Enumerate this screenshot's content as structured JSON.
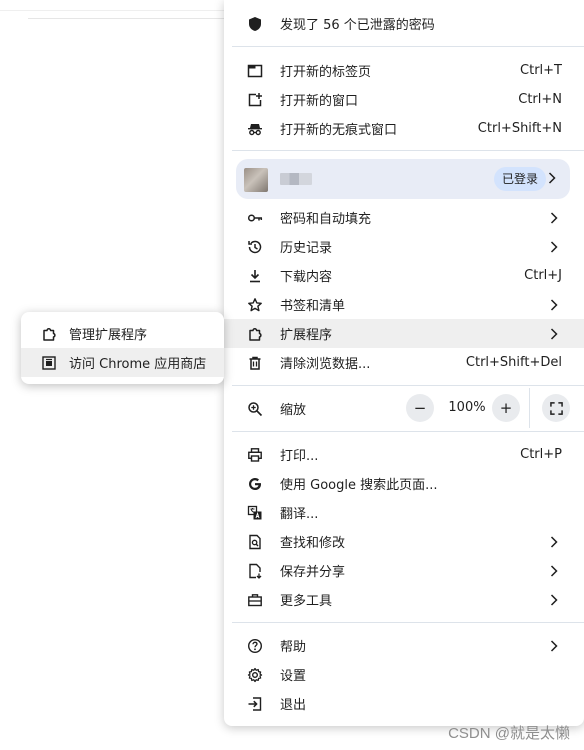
{
  "menu": {
    "password_alert": "发现了 56 个已泄露的密码",
    "new_tab": {
      "label": "打开新的标签页",
      "shortcut": "Ctrl+T"
    },
    "new_window": {
      "label": "打开新的窗口",
      "shortcut": "Ctrl+N"
    },
    "incognito": {
      "label": "打开新的无痕式窗口",
      "shortcut": "Ctrl+Shift+N"
    },
    "profile": {
      "status": "已登录"
    },
    "passwords": "密码和自动填充",
    "history": "历史记录",
    "downloads": {
      "label": "下载内容",
      "shortcut": "Ctrl+J"
    },
    "bookmarks": "书签和清单",
    "extensions": "扩展程序",
    "clear_data": {
      "label": "清除浏览数据...",
      "shortcut": "Ctrl+Shift+Del"
    },
    "zoom": {
      "label": "缩放",
      "value": "100%",
      "minus": "−",
      "plus": "+"
    },
    "print": {
      "label": "打印...",
      "shortcut": "Ctrl+P"
    },
    "google_search": "使用 Google 搜索此页面...",
    "translate": "翻译...",
    "find_edit": "查找和修改",
    "save_share": "保存并分享",
    "more_tools": "更多工具",
    "help": "帮助",
    "settings": "设置",
    "exit": "退出"
  },
  "submenu": {
    "manage_extensions": "管理扩展程序",
    "visit_store": "访问 Chrome 应用商店"
  },
  "watermark": "CSDN @就是太懒"
}
